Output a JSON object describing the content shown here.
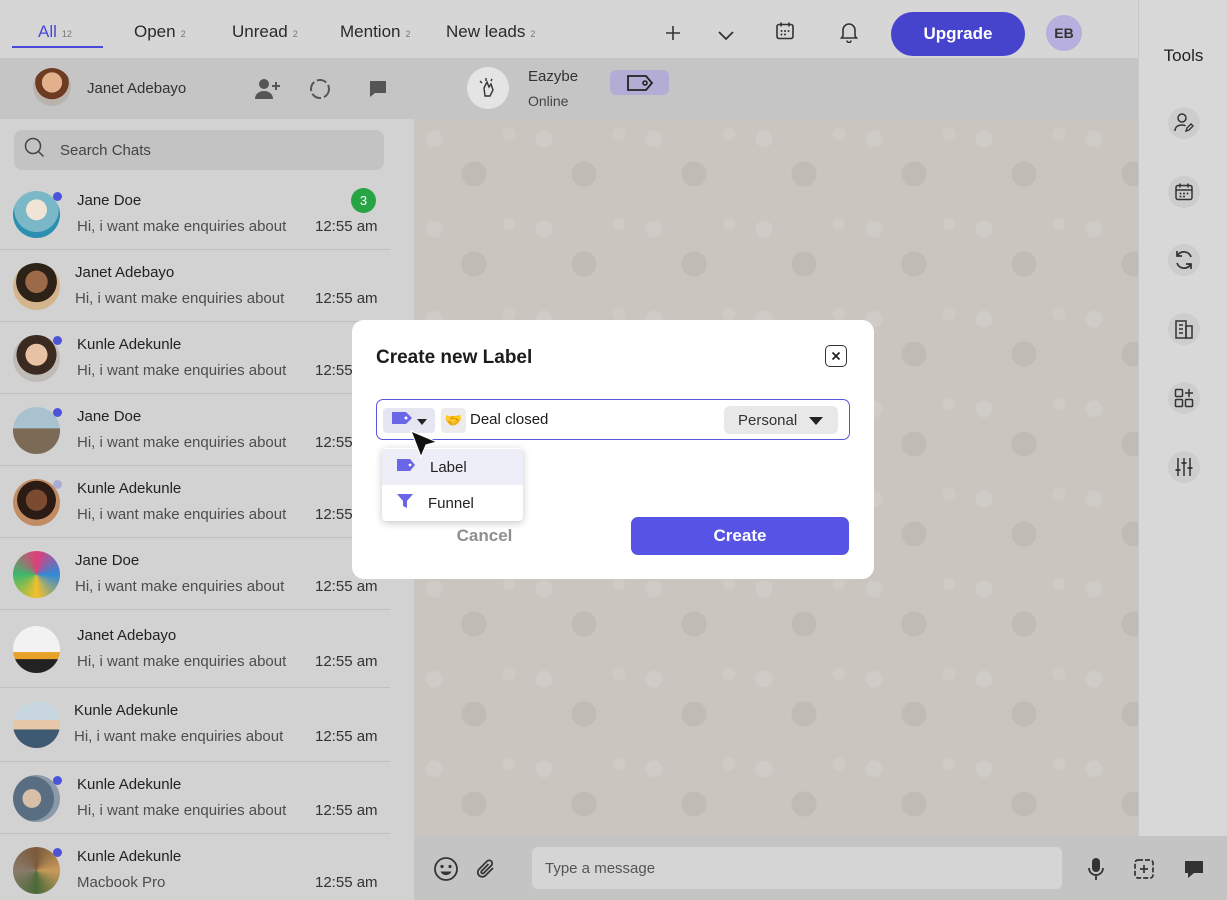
{
  "top_tabs": [
    {
      "label": "All",
      "count": "12",
      "active": true
    },
    {
      "label": "Open",
      "count": "2"
    },
    {
      "label": "Unread",
      "count": "2"
    },
    {
      "label": "Mention",
      "count": "2"
    },
    {
      "label": "New leads",
      "count": "2"
    }
  ],
  "topbar": {
    "upgrade_label": "Upgrade",
    "user_initials": "EB",
    "icons": [
      "plus-icon",
      "chevron-down-icon",
      "calendar-icon",
      "bell-icon"
    ]
  },
  "account": {
    "name": "Janet Adebayo"
  },
  "contact": {
    "name": "Eazybe",
    "status": "Online"
  },
  "search": {
    "placeholder": "Search Chats"
  },
  "chats": [
    {
      "name": "Jane Doe",
      "message": "Hi, i want make enquiries about",
      "time": "12:55 am",
      "unread": "3",
      "online": true
    },
    {
      "name": "Janet Adebayo",
      "message": "Hi, i want make enquiries about",
      "time": "12:55 am",
      "online": false
    },
    {
      "name": "Kunle Adekunle",
      "message": "Hi, i want make enquiries about",
      "time": "12:55",
      "online": true
    },
    {
      "name": "Jane Doe",
      "message": "Hi, i want make enquiries about",
      "time": "12:55",
      "online": true
    },
    {
      "name": "Kunle Adekunle",
      "message": "Hi, i want make enquiries about",
      "time": "12:55",
      "online": true
    },
    {
      "name": "Jane Doe",
      "message": "Hi, i want make enquiries about",
      "time": "12:55 am",
      "online": false
    },
    {
      "name": "Janet Adebayo",
      "message": "Hi, i want make enquiries about",
      "time": "12:55 am",
      "online": false
    },
    {
      "name": "Kunle Adekunle",
      "message": "Hi, i want make enquiries about",
      "time": "12:55 am",
      "online": false
    },
    {
      "name": "Kunle Adekunle",
      "message": "Hi, i want make enquiries about",
      "time": "12:55 am",
      "online": true
    },
    {
      "name": "Kunle Adekunle",
      "message": "Macbook Pro",
      "time": "12:55 am",
      "online": true
    }
  ],
  "composer": {
    "placeholder": "Type a message"
  },
  "tools": {
    "title": "Tools",
    "items": [
      "user-edit-icon",
      "calendar-icon",
      "sync-icon",
      "building-icon",
      "add-widget-icon",
      "sliders-icon"
    ]
  },
  "modal": {
    "title": "Create new Label",
    "label_name": "Deal closed",
    "emoji": "🤝",
    "scope": "Personal",
    "cancel_label": "Cancel",
    "create_label": "Create",
    "type_options": [
      {
        "label": "Label",
        "icon": "tag-icon"
      },
      {
        "label": "Funnel",
        "icon": "funnel-icon"
      }
    ]
  },
  "colors": {
    "accent": "#5753e4",
    "unread_badge": "#27a544",
    "online_dot": "#4b54d9"
  }
}
